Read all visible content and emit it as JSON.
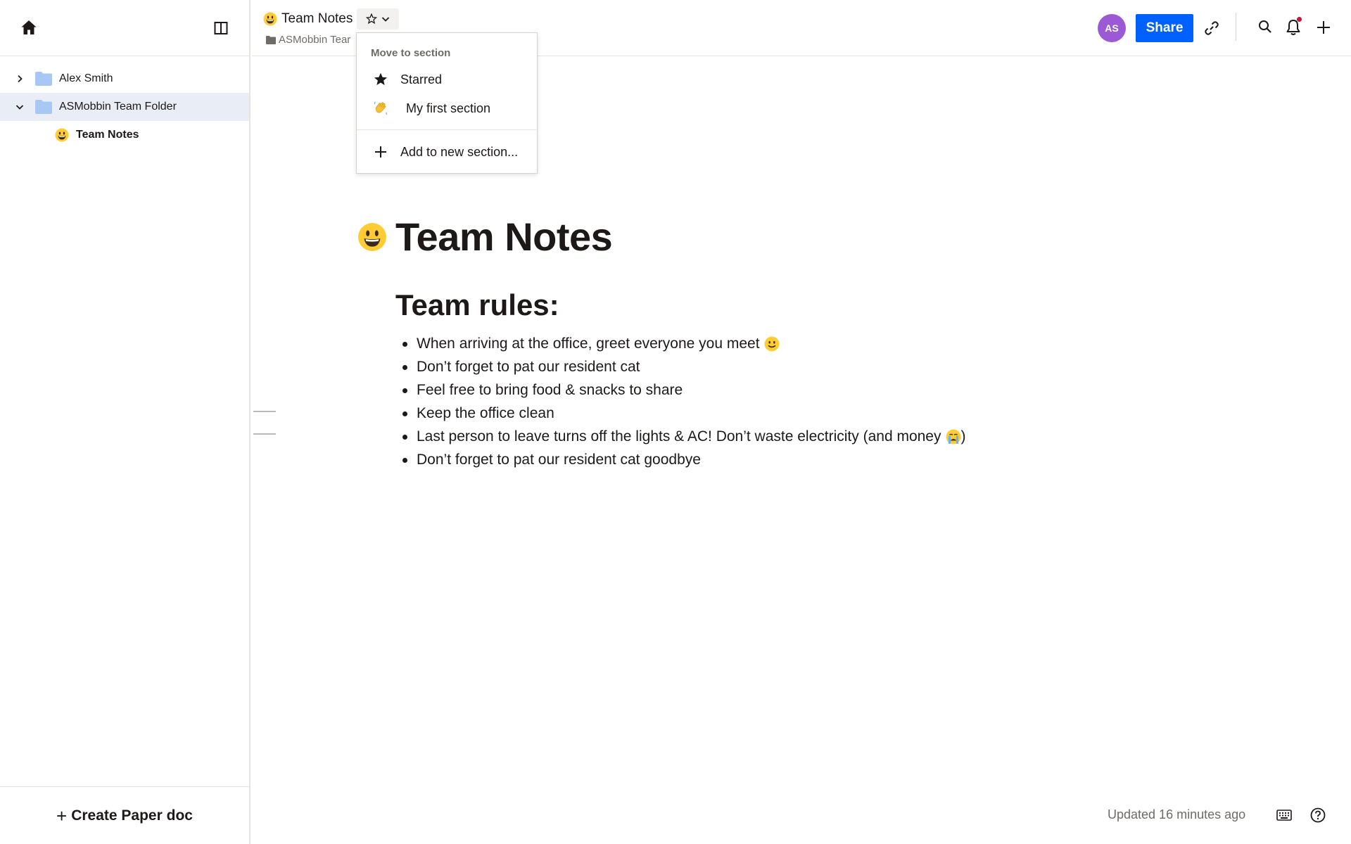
{
  "sidebar": {
    "tree": [
      {
        "label": "Alex Smith",
        "expanded": false,
        "icon": "folder-icon"
      },
      {
        "label": "ASMobbin Team Folder",
        "expanded": true,
        "selected": true,
        "icon": "folder-icon"
      },
      {
        "label": "Team Notes",
        "icon": "grinning-emoji"
      }
    ],
    "create_label": "Create Paper doc"
  },
  "topbar": {
    "doc_title": "Team Notes",
    "breadcrumb": "ASMobbin Tear",
    "avatar_initials": "AS",
    "share_label": "Share",
    "avatar_color": "#9b59d6",
    "share_color": "#0061fe"
  },
  "dropdown": {
    "header": "Move to section",
    "items": [
      {
        "label": "Starred",
        "icon": "star-icon"
      },
      {
        "label": "My first section",
        "icon": "waving-hand-emoji"
      },
      {
        "label": "Add to new section...",
        "icon": "plus-icon"
      }
    ]
  },
  "document": {
    "title": "Team Notes",
    "heading": "Team rules:",
    "bullets": [
      "When arriving at the office, greet everyone you meet",
      "Don’t forget to pat our resident cat",
      "Feel free to bring food & snacks to share",
      "Keep the office clean",
      "Last person to leave turns off the lights & AC! Don’t waste electricity (and money",
      "Don’t forget to pat our resident cat goodbye"
    ],
    "bullet_suffix_5": ")"
  },
  "footer": {
    "updated": "Updated 16 minutes ago"
  }
}
